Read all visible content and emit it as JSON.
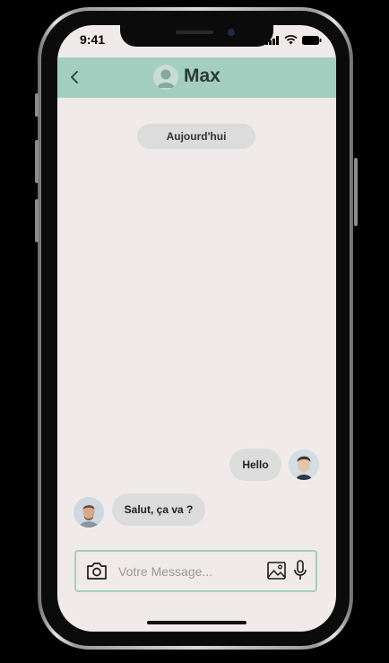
{
  "status_bar": {
    "time": "9:41",
    "icons": [
      "signal-icon",
      "wifi-icon",
      "battery-icon"
    ]
  },
  "header": {
    "back_icon": "chevron-left-icon",
    "contact_name": "Max",
    "avatar_icon": "user-avatar-icon",
    "background_color": "#a3cfc0"
  },
  "chat": {
    "date_separator": "Aujourd'hui",
    "messages": [
      {
        "sender": "me",
        "text": "Hello"
      },
      {
        "sender": "contact",
        "text": "Salut, ça va ?"
      }
    ]
  },
  "composer": {
    "placeholder": "Votre Message...",
    "value": "",
    "camera_icon": "camera-icon",
    "image_icon": "image-icon",
    "mic_icon": "microphone-icon"
  },
  "colors": {
    "accent": "#a3cfc0",
    "background": "#f0ebea",
    "bubble": "#dcdcdc"
  }
}
